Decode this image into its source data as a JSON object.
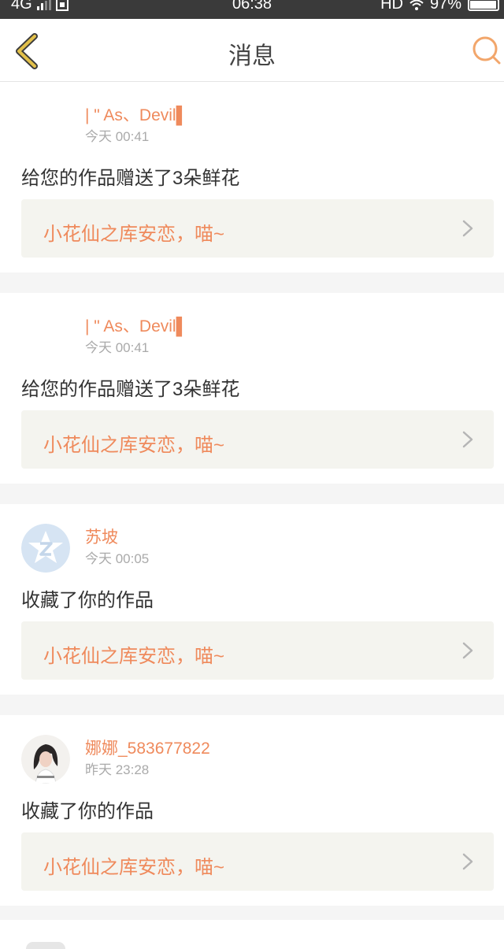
{
  "status_bar": {
    "network": "4G",
    "time": "06:38",
    "hd": "HD",
    "battery": "97%",
    "battery_level": 0.97
  },
  "header": {
    "title": "消息",
    "back_icon": "chevron-left-icon",
    "search_icon": "search-icon"
  },
  "colors": {
    "accent": "#ef8a5c",
    "back_icon": "#d9b23a",
    "search_icon": "#f2a66b"
  },
  "messages": [
    {
      "user": "| \" As、Devil▌",
      "time": "今天 00:41",
      "text": "给您的作品赠送了3朵鲜花",
      "work_title": "小花仙之库安恋，喵~",
      "avatar": "none"
    },
    {
      "user": "| \" As、Devil▌",
      "time": "今天 00:41",
      "text": "给您的作品赠送了3朵鲜花",
      "work_title": "小花仙之库安恋，喵~",
      "avatar": "none"
    },
    {
      "user": "苏坡",
      "time": "今天 00:05",
      "text": "收藏了你的作品",
      "work_title": "小花仙之库安恋，喵~",
      "avatar": "default-star-avatar-icon"
    },
    {
      "user": "娜娜_583677822",
      "time": "昨天 23:28",
      "text": "收藏了你的作品",
      "work_title": "小花仙之库安恋，喵~",
      "avatar": "user-photo-avatar"
    }
  ]
}
